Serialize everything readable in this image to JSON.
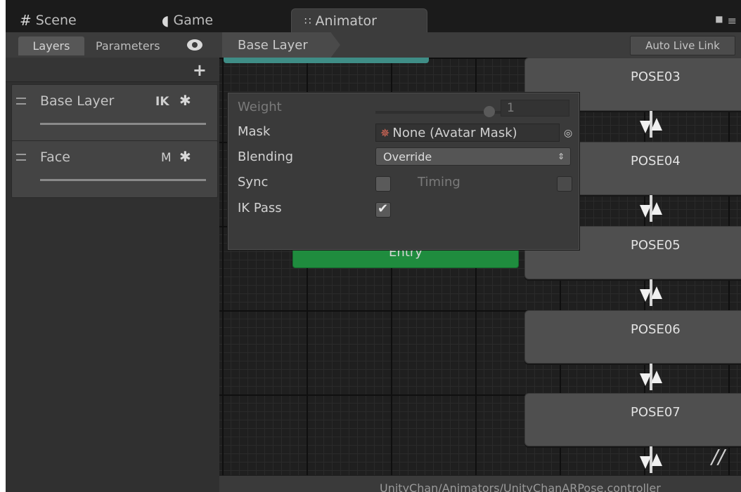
{
  "tabs": {
    "scene": {
      "icon": "#",
      "label": "Scene"
    },
    "game": {
      "icon": "◖",
      "label": "Game"
    },
    "animator": {
      "icon": "∷",
      "label": "Animator"
    },
    "lock_icon": "🔒",
    "menu_icon": "≡"
  },
  "toolbar": {
    "layers_tab": "Layers",
    "parameters_tab": "Parameters",
    "breadcrumb": "Base Layer",
    "auto_live_link": "Auto Live Link"
  },
  "left_panel": {
    "add_button": "+",
    "layers": [
      {
        "name": "Base Layer",
        "flag": "IK",
        "gear": "✱"
      },
      {
        "name": "Face",
        "flag": "M",
        "gear": "✱"
      }
    ]
  },
  "layer_settings": {
    "weight_label": "Weight",
    "weight_value": "1",
    "weight_level": 1.0,
    "mask_label": "Mask",
    "mask_icon": "✵",
    "mask_value": "None (Avatar Mask)",
    "picker_icon": "◎",
    "blending_label": "Blending",
    "blending_value": "Override",
    "sync_label": "Sync",
    "sync_checked": false,
    "timing_label": "Timing",
    "timing_checked": false,
    "ikpass_label": "IK Pass",
    "ikpass_checked": true
  },
  "graph": {
    "entry_label": "Entry",
    "states": [
      "POSE03",
      "POSE04",
      "POSE05",
      "POSE06",
      "POSE07"
    ],
    "more": "//"
  },
  "status_bar": {
    "path": "UnityChan/Animators/UnityChanARPose.controller"
  }
}
